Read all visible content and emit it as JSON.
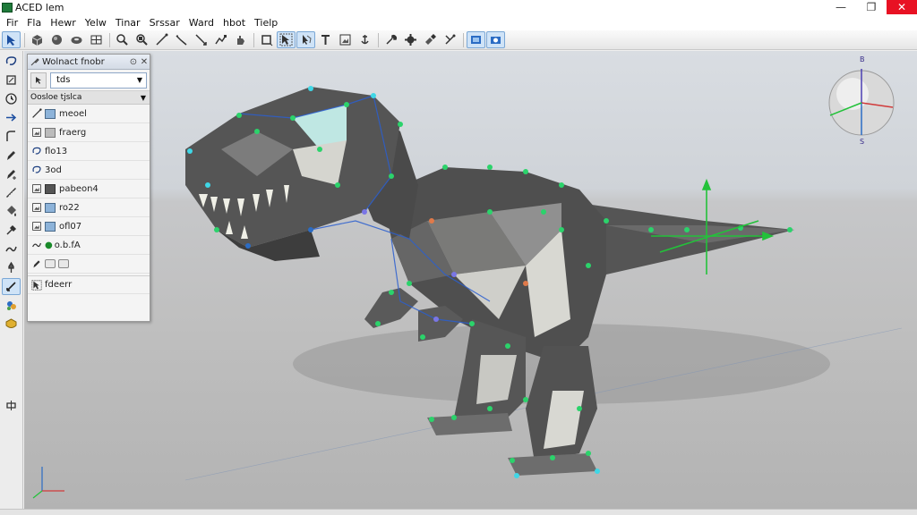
{
  "window": {
    "title": "ACED lem",
    "minimize_glyph": "—",
    "maximize_glyph": "❐",
    "close_glyph": "✕"
  },
  "menu": [
    "Fir",
    "Fla",
    "Hewr",
    "Yelw",
    "Tinar",
    "Srssar",
    "Ward",
    "hbot",
    "Tielp"
  ],
  "toolbar": {
    "icons": [
      "select-arrow-icon",
      "cube-icon",
      "sphere-icon",
      "torus-icon",
      "grid-icon",
      "zoom-icon",
      "zoom-region-icon",
      "line-icon",
      "bend-icon",
      "knife-icon",
      "snap-icon",
      "hand-icon",
      "frame-icon",
      "select-box-icon",
      "lasso-icon",
      "text-icon",
      "image-icon",
      "anchor-icon",
      "wrench-icon",
      "gear-icon",
      "paint-icon",
      "bones-icon",
      "render-icon",
      "camera-icon"
    ],
    "active": [
      0,
      13,
      14,
      22,
      23
    ]
  },
  "toolstrip": {
    "icons": [
      "lasso-tool-icon",
      "paint-tool-icon",
      "clock-icon",
      "arrow-right-icon",
      "curve-tool-icon",
      "pen-icon",
      "pen-add-icon",
      "measure-icon",
      "bucket-icon",
      "pipette-icon",
      "sculpt-icon",
      "pin-icon",
      "knife-tool-icon",
      "materials-icon",
      "shield-icon",
      "transform-icon"
    ],
    "active": [
      12
    ]
  },
  "panel": {
    "title": "Wolnact fnobr",
    "close_glyph": "✕",
    "pin_glyph": "⊙",
    "selector_value": "tds",
    "section_title": "Oosloe tjslca",
    "rows": [
      {
        "label": "meoel"
      },
      {
        "label": "fraerg"
      },
      {
        "label": "flo13"
      },
      {
        "label": "3od"
      },
      {
        "label": "pabeon4"
      },
      {
        "label": "ro22"
      },
      {
        "label": "ofl07"
      },
      {
        "label": "o.b.fA"
      },
      {
        "label": ""
      },
      {
        "label": "fdeerr"
      }
    ]
  },
  "gizmo": {
    "top_label": "B",
    "bottom_label": "S"
  },
  "colors": {
    "accent": "#2b6cc4",
    "vertex_green": "#2bd36b",
    "vertex_cyan": "#3fd7e6",
    "mesh_dark": "#4d4d4d",
    "mesh_light": "#d8d8d2",
    "gizmo_green": "#23c23a"
  }
}
